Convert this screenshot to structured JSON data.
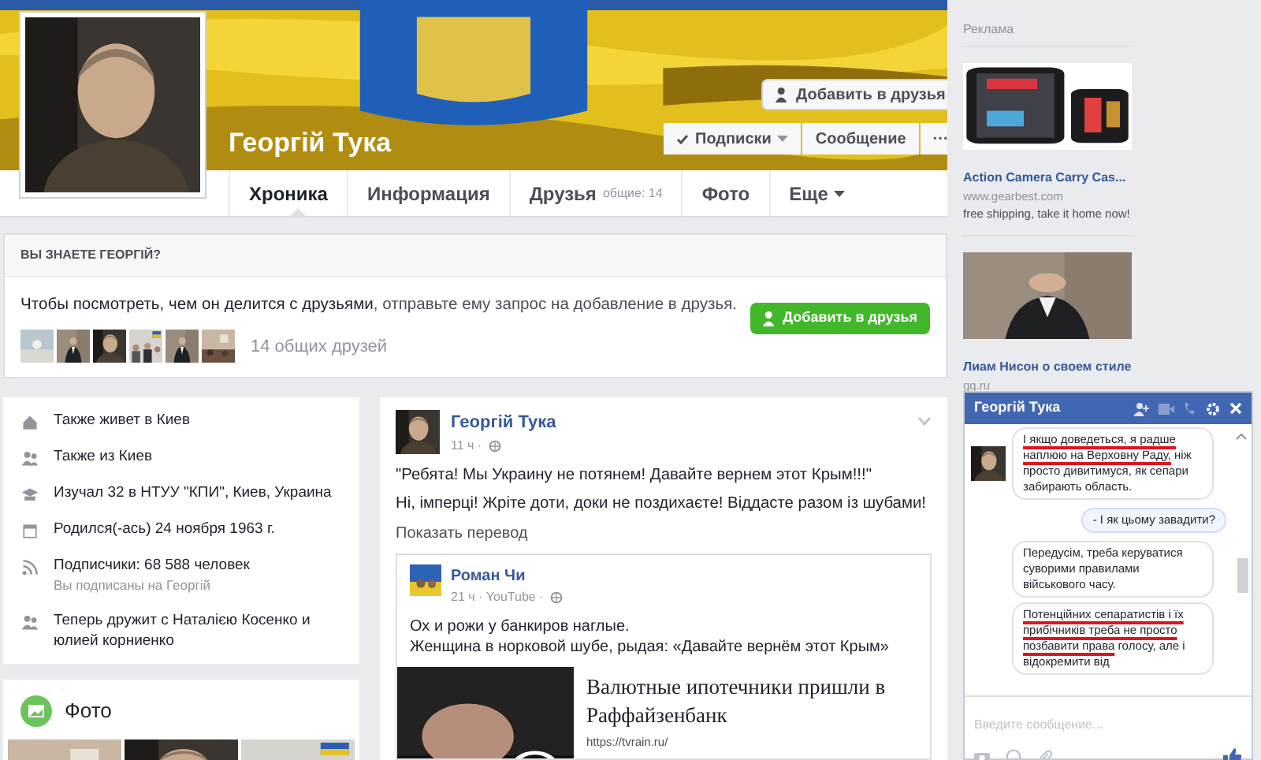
{
  "profile": {
    "name": "Георгій Тука",
    "add_friend": "Добавить в друзья",
    "follow": "Подписки",
    "message": "Сообщение",
    "more": "···"
  },
  "nav": [
    {
      "label": "Хроника",
      "selected": true
    },
    {
      "label": "Информация",
      "selected": false
    },
    {
      "label": "Друзья",
      "count": "общие: 14",
      "selected": false
    },
    {
      "label": "Фото",
      "selected": false
    },
    {
      "label": "Еще",
      "dropdown": true,
      "selected": false
    }
  ],
  "know": {
    "title": "ВЫ ЗНАЕТЕ ГЕОРГІЙ?",
    "text": "Чтобы посмотреть, чем он делится с друзьями",
    "text_rest": ", отправьте ему запрос на добавление в друзья.",
    "button": "Добавить в друзья",
    "mutual": "14 общих друзей"
  },
  "intro": [
    {
      "text": "Также живет в Киев"
    },
    {
      "text": "Также из Киев"
    },
    {
      "text": "Изучал 32 в НТУУ \"КПИ\", Киев, Украина"
    },
    {
      "text": "Родился(-ась) 24 ноября 1963 г."
    },
    {
      "text": "Подписчики: 68 588 человек",
      "sub": "Вы подписаны на Георгій"
    },
    {
      "text": "Теперь дружит с Наталією Косенко и юлией корниенко"
    }
  ],
  "photos": {
    "title": "Фото"
  },
  "post": {
    "author": "Георгій Тука",
    "time": "11 ч ·",
    "paragraphs": [
      "\"Ребята! Мы Украину не потянем! Давайте вернем этот Крым!!!\"",
      "Ні, імперці! Жріте доти, доки не поздихаєте! Віддасте разом із шубами!"
    ],
    "translate": "Показать перевод",
    "shared": {
      "author": "Роман Чи",
      "meta": "21 ч · YouTube ·",
      "lines": [
        "Ох и рожи у банкиров наглые.",
        "Женщина в норковой шубе, рыдая: «Давайте вернём этот Крым»"
      ],
      "link_title": "Валютные ипотечники пришли в Раффайзенбанк",
      "link_url": "https://tvrain.ru/"
    }
  },
  "ads": {
    "title": "Реклама",
    "items": [
      {
        "title": "Action Camera Carry Cas...",
        "site": "www.gearbest.com",
        "text": "free shipping, take it home now!"
      },
      {
        "title": "Лиам Нисон о своем стиле",
        "site": "gq.ru"
      }
    ]
  },
  "chat": {
    "title": "Георгій Тука",
    "messages": [
      {
        "kind": "incoming",
        "avatar": true,
        "segments": [
          {
            "text": "І якщо доведеться, я радше наплюю на Верховну Раду,",
            "marked": true
          },
          {
            "text": " ніж просто дивитимуся, як сепари забирають область.",
            "marked": false
          }
        ]
      },
      {
        "kind": "outgoing",
        "segments": [
          {
            "text": "- І як цьому завадити?",
            "marked": false
          }
        ]
      },
      {
        "kind": "incoming",
        "avatar": false,
        "segments": [
          {
            "text": "Передусім, треба керуватися суворими правилами військового часу.",
            "marked": false
          }
        ]
      },
      {
        "kind": "incoming",
        "avatar": false,
        "segments": [
          {
            "text": "Потенційних сепаратистів і їх прибічників треба не просто позбавити права",
            "marked": true
          },
          {
            "text": " голосу, але і відокремити від",
            "marked": false
          }
        ]
      }
    ],
    "placeholder": "Введите сообщение..."
  }
}
